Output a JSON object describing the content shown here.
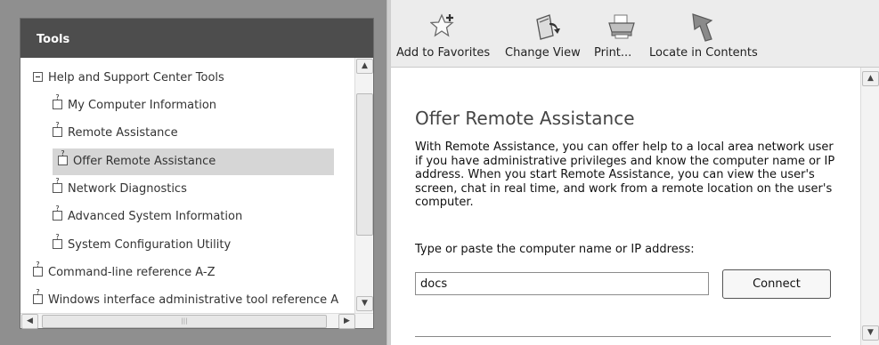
{
  "left_pane": {
    "title": "Tools",
    "tree": [
      {
        "label": "Help and Support Center Tools",
        "icon": "collapse-minus-icon",
        "level": 0,
        "selected": false
      },
      {
        "label": "My Computer Information",
        "icon": "help-topic-icon",
        "level": 1,
        "selected": false
      },
      {
        "label": "Remote Assistance",
        "icon": "help-topic-icon",
        "level": 1,
        "selected": false
      },
      {
        "label": "Offer Remote Assistance",
        "icon": "help-topic-icon",
        "level": 1,
        "selected": true
      },
      {
        "label": "Network Diagnostics",
        "icon": "help-topic-icon",
        "level": 1,
        "selected": false
      },
      {
        "label": "Advanced System Information",
        "icon": "help-topic-icon",
        "level": 1,
        "selected": false
      },
      {
        "label": "System Configuration Utility",
        "icon": "help-topic-icon",
        "level": 1,
        "selected": false
      },
      {
        "label": "Command-line reference A-Z",
        "icon": "help-topic-icon",
        "level": 0,
        "selected": false
      },
      {
        "label": "Windows interface administrative tool reference A",
        "icon": "help-topic-icon",
        "level": 0,
        "selected": false
      }
    ]
  },
  "toolbar": {
    "add_favorites": {
      "label": "Add to Favorites",
      "icon": "star-plus-icon"
    },
    "change_view": {
      "label": "Change View",
      "icon": "change-view-icon"
    },
    "print": {
      "label": "Print...",
      "icon": "printer-icon"
    },
    "locate": {
      "label": "Locate in Contents",
      "icon": "locate-arrow-icon"
    }
  },
  "content": {
    "title": "Offer Remote Assistance",
    "description": "With Remote Assistance, you can offer help to a local area network user if you have administrative privileges and know the computer name or IP address. When you start Remote Assistance, you can view the user's screen, chat in real time, and work from a remote location on the user's computer.",
    "address_prompt": "Type or paste the computer name or IP address:",
    "address_value": "docs",
    "connect_label": "Connect"
  },
  "colors": {
    "tools_header_bg": "#4d4d4d",
    "selected_item_bg": "#d6d6d6"
  }
}
